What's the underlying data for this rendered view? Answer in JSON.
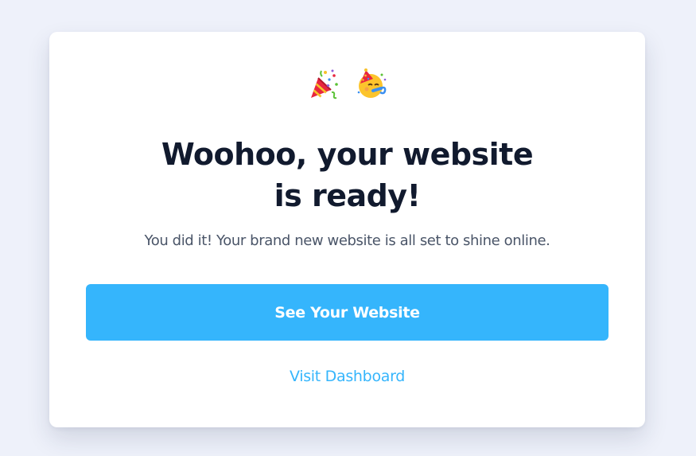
{
  "emojis": [
    "party-popper-icon",
    "partying-face-icon"
  ],
  "modal": {
    "title_line_1": "Woohoo, your website",
    "title_line_2": "is ready!",
    "subtitle": "You did it! Your brand new website is all set to shine online.",
    "primary_button_label": "See Your Website",
    "secondary_link_label": "Visit Dashboard"
  },
  "colors": {
    "background": "#eef1fa",
    "card": "#ffffff",
    "title": "#111a2e",
    "subtitle": "#4a5568",
    "accent": "#35b5fc"
  }
}
